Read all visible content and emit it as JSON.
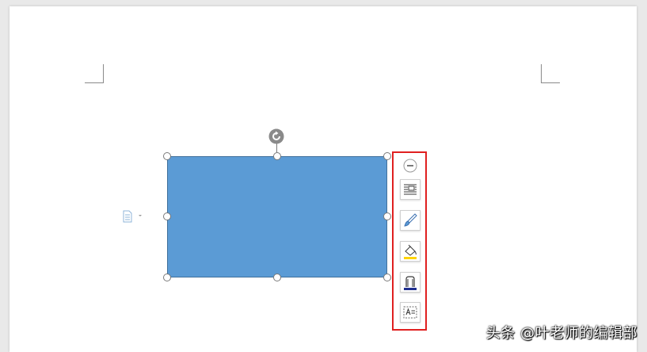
{
  "document": {
    "selected_shape": {
      "type": "rectangle",
      "fill_color": "#5b9bd5",
      "border_color": "#41719c"
    }
  },
  "layout_panel": {
    "highlight_color": "#e02020",
    "buttons": [
      {
        "icon": "collapse-icon"
      },
      {
        "icon": "wrap-text-icon"
      },
      {
        "icon": "shape-style-brush-icon"
      },
      {
        "icon": "shape-fill-icon"
      },
      {
        "icon": "shape-outline-icon"
      },
      {
        "icon": "text-box-icon"
      }
    ]
  },
  "watermark": {
    "text": "头条 @叶老师的编辑部"
  }
}
